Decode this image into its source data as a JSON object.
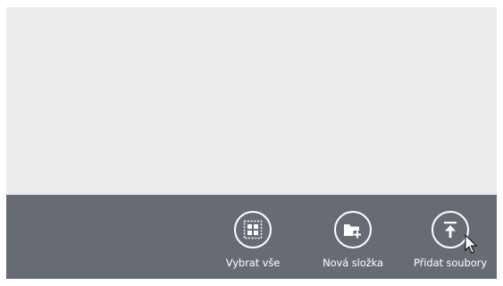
{
  "app_bar": {
    "commands": [
      {
        "label": "Vybrat vše",
        "icon": "select-all-icon"
      },
      {
        "label": "Nová složka",
        "icon": "new-folder-icon"
      },
      {
        "label": "Přidat soubory",
        "icon": "upload-icon"
      }
    ]
  },
  "colors": {
    "content_background": "#ececec",
    "app_bar_background": "#676c74",
    "foreground": "#ffffff"
  }
}
